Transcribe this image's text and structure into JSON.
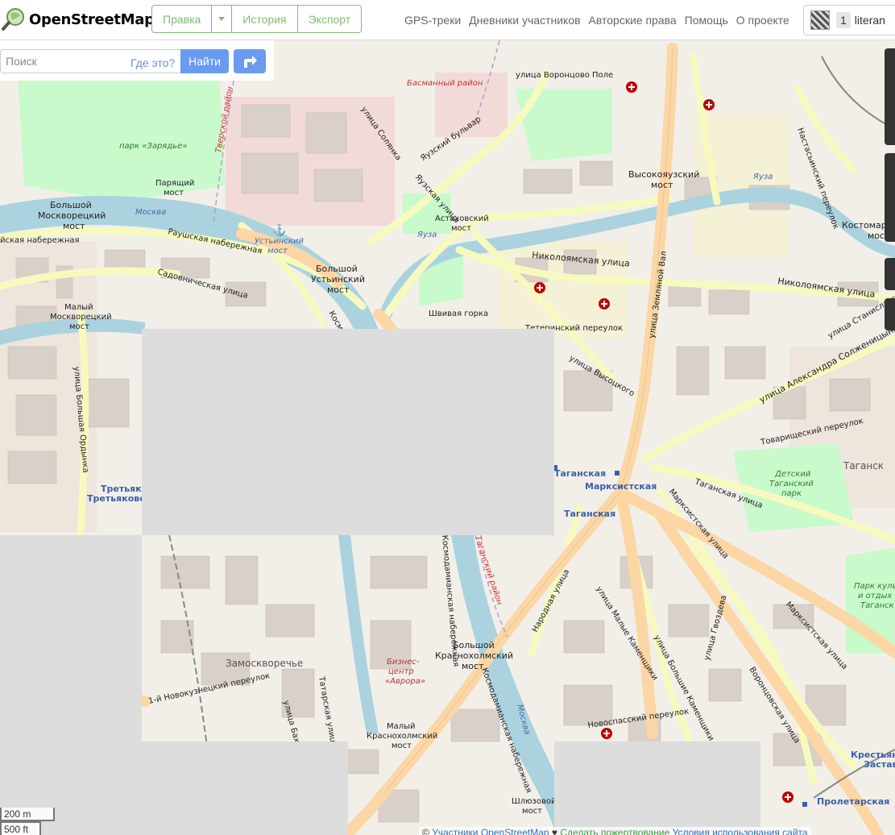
{
  "header": {
    "brand": "OpenStreetMap",
    "edit_label": "Правка",
    "history_label": "История",
    "export_label": "Экспорт",
    "nav": [
      "GPS-треки",
      "Дневники участников",
      "Авторские права",
      "Помощь",
      "О проекте"
    ],
    "user_badge": "1",
    "username": "literan"
  },
  "search": {
    "placeholder": "Поиск",
    "where_label": "Где это?",
    "go_label": "Найти"
  },
  "map": {
    "labels": {
      "park_zaryadye": "парк «Зарядье»",
      "parjashchiy": "Парящий",
      "most": "мост",
      "bolshoy": "Большой",
      "moskvoretskiy": "Москворецкий",
      "moskva_river": "Москва",
      "raushskaya": "Раушская набережная",
      "kaya_nab": "йская набережная",
      "ustinsky_most_italic": "Устьинский",
      "ustinsky": "Устьинский",
      "sadovnicheskaya": "Садовническая улица",
      "maly": "Малый",
      "solyanka": "улица Солянка",
      "yauzsky_bul": "Яузский бульвар",
      "yauzskaya_ul": "Яузская улица",
      "astakhovsky": "Астаховский",
      "yauza": "Яуза",
      "basmanny": "Басманный район",
      "vorontsovo_pole": "улица Воронцово Поле",
      "vysokoyauzsky": "Высокояузский",
      "nikoloyamskaya": "Николоямская улица",
      "zemlyanoy_val": "улица Земляной Вал",
      "shvivaya": "Швивая горка",
      "teterinsky": "Тетеринский переулок",
      "vysotskogo": "улица Высоцкого",
      "solzhenitsyna": "улица Александра Солженицына",
      "stanislavskogo": "улица Станиславского",
      "tovarishchesky": "Товарищеский переулок",
      "taganskaya": "Таганская",
      "marksistskaya": "Марксистская",
      "taganskaya_ul": "Таганская улица",
      "marksistskaya_ul": "Марксистская улица",
      "detsky_park": "Детский",
      "taganskiy_park": "Таганский",
      "park": "парк",
      "kostomarovsky": "Костомаров",
      "taganskiy": "Таганск",
      "tretyakovskaya": "Третьяко",
      "tretyakovskaya2": "Третьяковск",
      "bolshaya_ordynka": "улица Большая Ордынка",
      "zamoskvorechye": "Замоскворечье",
      "krasnokholmsky": "Краснохолмский",
      "biznes": "Бизнес-",
      "centr": "центр",
      "avrora": "«Аврора»",
      "kosmodamianskaya": "Космодамианская набережная",
      "narodnaya": "Народная улица",
      "bolshie_kamenshchiki": "улица Большие Каменщики",
      "vorontsovskaya": "Воронцовская улица",
      "shlyuzovoy": "Шлюзовой",
      "proletarskaya": "Пролетарская",
      "krestyanskaya": "Крестьянс",
      "zastava": "Застава",
      "moskva_river2": "Москва",
      "kultura1": "Парк культу",
      "kultura2": "и отдых",
      "kultura3": "Таганск",
      "novospassky": "Новоспасский переулок",
      "gvozdeva": "улица Гвоздева",
      "malye_kamenshchiki": "улица Малые Каменщики",
      "novokuznetsky": "1-й Новокузнецкий переулок",
      "bakhrushina": "улица Бахрушина",
      "tatarskaya": "Татарская улица",
      "kosmo": "Космо",
      "nastasinsky": "Настасьинский переулок",
      "tverskoy": "Тверской район",
      "taganskiy_rayon": "Таганский район"
    }
  },
  "scale": {
    "metric": "200 m",
    "imperial": "500 ft"
  },
  "attribution": {
    "copy": "©",
    "contributors": "Участники OpenStreetMap",
    "sep": "♥",
    "donate": "Сделать пожертвование",
    "terms": "Условия использования сайта"
  },
  "colors": {
    "brand_green": "#7ebc6f",
    "search_blue": "#6b9bf0",
    "water": "#aad3df",
    "major_road": "#fcd6a4",
    "secondary_road": "#f7fabf",
    "park": "#c8facc",
    "building": "#d9d0c9",
    "tile_missing": "#dddddd"
  }
}
